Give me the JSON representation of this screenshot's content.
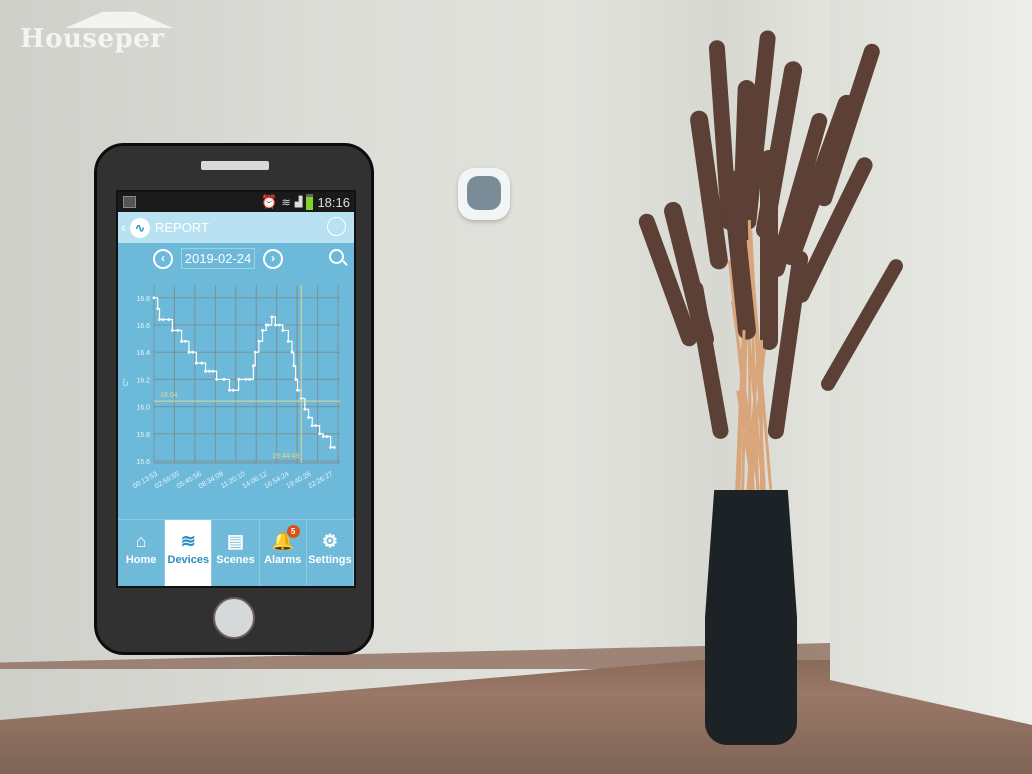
{
  "brand": {
    "logo_text": "Houseper"
  },
  "phone": {
    "status_bar": {
      "time": "18:16",
      "icons": [
        "gallery-icon",
        "alarm-clock-icon",
        "wifi-icon",
        "signal-icon",
        "battery-icon"
      ]
    },
    "header": {
      "title": "REPORT",
      "logo_icon": "report-logo-icon",
      "globe_icon": "globe-icon"
    },
    "date_nav": {
      "date": "2019-02-24",
      "prev_label": "‹",
      "next_label": "›"
    },
    "tabs": [
      {
        "label": "Home",
        "icon": "⌂",
        "active": false
      },
      {
        "label": "Devices",
        "icon": "≋",
        "active": true
      },
      {
        "label": "Scenes",
        "icon": "▤",
        "active": false
      },
      {
        "label": "Alarms",
        "icon": "🔔",
        "active": false,
        "badge": "5"
      },
      {
        "label": "Settings",
        "icon": "⚙",
        "active": false
      }
    ]
  },
  "chart_data": {
    "type": "line",
    "title": "",
    "ylabel": "C°",
    "xlabel": "",
    "ylim": [
      15.6,
      16.85
    ],
    "yticks": [
      15.6,
      15.8,
      16.0,
      16.2,
      16.4,
      16.6,
      16.8
    ],
    "ytick_labels": [
      "15.6",
      "15.8",
      "16.0",
      "16.2",
      "16.4",
      "16.6",
      "16.8"
    ],
    "xtick_labels": [
      "00:13:53",
      "02:59:55",
      "05:45:56",
      "08:34:09",
      "11:20:10",
      "14:06:12",
      "16:54:24",
      "19:40:26",
      "22:26:27"
    ],
    "grid": true,
    "cursor": {
      "value_label": "16.04",
      "value": 16.04,
      "time_label": "19:44:48",
      "time_fraction": 0.8
    },
    "series": [
      {
        "name": "temperature",
        "x": [
          0.0,
          0.02,
          0.03,
          0.05,
          0.08,
          0.1,
          0.13,
          0.15,
          0.17,
          0.19,
          0.21,
          0.23,
          0.26,
          0.28,
          0.3,
          0.32,
          0.34,
          0.38,
          0.41,
          0.43,
          0.46,
          0.5,
          0.52,
          0.54,
          0.55,
          0.57,
          0.59,
          0.61,
          0.62,
          0.64,
          0.66,
          0.68,
          0.7,
          0.73,
          0.75,
          0.76,
          0.77,
          0.78,
          0.8,
          0.82,
          0.84,
          0.86,
          0.88,
          0.9,
          0.92,
          0.94,
          0.96,
          0.98
        ],
        "y": [
          16.8,
          16.72,
          16.64,
          16.64,
          16.64,
          16.56,
          16.56,
          16.48,
          16.48,
          16.4,
          16.4,
          16.32,
          16.32,
          16.26,
          16.26,
          16.26,
          16.2,
          16.2,
          16.12,
          16.12,
          16.2,
          16.2,
          16.2,
          16.3,
          16.4,
          16.48,
          16.56,
          16.6,
          16.6,
          16.66,
          16.6,
          16.6,
          16.56,
          16.48,
          16.4,
          16.3,
          16.2,
          16.12,
          16.06,
          15.98,
          15.92,
          15.86,
          15.86,
          15.8,
          15.78,
          15.78,
          15.7,
          15.7
        ]
      }
    ]
  }
}
